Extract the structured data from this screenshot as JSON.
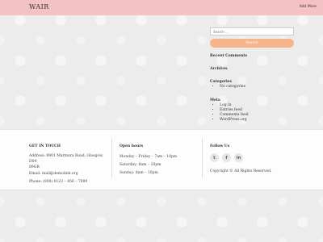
{
  "header": {
    "logo": "WAIR",
    "link": "Add More",
    "color": "#f4c2c2"
  },
  "sidebar": {
    "search_placeholder": "Search ...",
    "search_button": "Search",
    "recent_comments": "Recent Comments",
    "archives": "Archives",
    "categories": {
      "title": "Categories",
      "items": [
        "No categories"
      ]
    },
    "meta": {
      "title": "Meta",
      "items": [
        "Log in",
        "Entries feed",
        "Comments feed",
        "WordPress.org"
      ]
    }
  },
  "footer": {
    "contact": {
      "title": "GET IN TOUCH",
      "address_line1": "Address: 8901 Marmora Road, Glasgow, D04",
      "address_line2": "89GR",
      "email": "Email: mail@demolink.org",
      "phone": "Phone: (800) 0123 – 456 – 7890"
    },
    "hours": {
      "title": "Open hours",
      "lines": [
        "Monday – Friday – 7am – 10pm",
        "Saturday: 8am – 10pm",
        "Sunday: 8am – 10pm"
      ]
    },
    "follow": {
      "title": "Follow Us",
      "icons": [
        "twitter-icon",
        "facebook-icon",
        "linkedin-icon"
      ],
      "glyphs": [
        "t",
        "f",
        "in"
      ],
      "copyright": "Copyright © All Rights Reserved."
    }
  },
  "colors": {
    "accent": "#f6b48a",
    "header": "#f4c2c2"
  }
}
